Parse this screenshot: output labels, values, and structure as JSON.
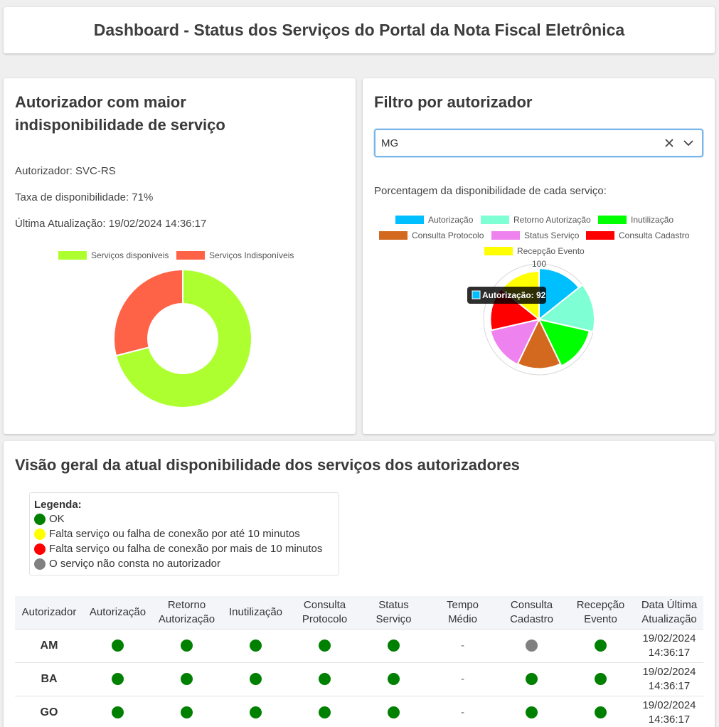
{
  "header": {
    "title": "Dashboard - Status dos Serviços do Portal da Nota Fiscal Eletrônica"
  },
  "left_card": {
    "title_line1": "Autorizador com maior",
    "title_line2": "indisponibilidade de serviço",
    "autorizador": "Autorizador: SVC-RS",
    "taxa": "Taxa de disponibilidade: 71%",
    "ultima": "Última Atualização: 19/02/2024 14:36:17",
    "chart_data": {
      "type": "pie",
      "variant": "doughnut",
      "categories": [
        "Serviços disponíveis",
        "Serviços Indisponíveis"
      ],
      "values": [
        71,
        29
      ],
      "colors": [
        "#adff2f",
        "#ff6347"
      ],
      "legend": "top"
    }
  },
  "right_card": {
    "title": "Filtro por autorizador",
    "select": {
      "value": "MG",
      "clear_icon": "close-icon",
      "open_icon": "chevron-down-icon"
    },
    "subtitle": "Porcentagem da disponibilidade de cada serviço:",
    "chart_data": {
      "type": "polarArea",
      "categories": [
        "Autorização",
        "Retorno Autorização",
        "Inutilização",
        "Consulta Protocolo",
        "Status Serviço",
        "Consulta Cadastro",
        "Recepção Evento"
      ],
      "values": [
        92,
        100,
        93,
        89,
        90,
        88,
        87
      ],
      "colors": [
        "#00bfff",
        "#7fffd4",
        "#00ff00",
        "#d2691e",
        "#ee82ee",
        "#ff0000",
        "#ffff00"
      ],
      "r_max": 100,
      "tick_label": "100",
      "legend": "top",
      "tooltip": {
        "label": "Autorização: 92",
        "color": "#00bfff"
      }
    }
  },
  "bottom_card": {
    "title": "Visão geral da atual disponibilidade dos serviços dos autorizadores",
    "legend": {
      "title": "Legenda:",
      "items": [
        {
          "color": "#008000",
          "label": "OK"
        },
        {
          "color": "#ffff00",
          "label": "Falta serviço ou falha de conexão por até 10 minutos"
        },
        {
          "color": "#ff0000",
          "label": "Falta serviço ou falha de conexão por mais de 10 minutos"
        },
        {
          "color": "#808080",
          "label": "O serviço não consta no autorizador"
        }
      ]
    },
    "table": {
      "headers": [
        [
          "Autorizador"
        ],
        [
          "Autorização"
        ],
        [
          "Retorno",
          "Autorização"
        ],
        [
          "Inutilização"
        ],
        [
          "Consulta",
          "Protocolo"
        ],
        [
          "Status",
          "Serviço"
        ],
        [
          "Tempo",
          "Médio"
        ],
        [
          "Consulta",
          "Cadastro"
        ],
        [
          "Recepção",
          "Evento"
        ],
        [
          "Data Última",
          "Atualização"
        ]
      ],
      "status_colors": {
        "ok": "#008000",
        "na": "#808080",
        "warn": "#ffff00",
        "err": "#ff0000"
      },
      "rows": [
        {
          "autorizador": "AM",
          "status": [
            "ok",
            "ok",
            "ok",
            "ok",
            "ok"
          ],
          "tempo": "-",
          "cadastro": "na",
          "evento": "ok",
          "data": "19/02/2024",
          "hora": "14:36:17"
        },
        {
          "autorizador": "BA",
          "status": [
            "ok",
            "ok",
            "ok",
            "ok",
            "ok"
          ],
          "tempo": "-",
          "cadastro": "ok",
          "evento": "ok",
          "data": "19/02/2024",
          "hora": "14:36:17"
        },
        {
          "autorizador": "GO",
          "status": [
            "ok",
            "ok",
            "ok",
            "ok",
            "ok"
          ],
          "tempo": "-",
          "cadastro": "ok",
          "evento": "ok",
          "data": "19/02/2024",
          "hora": "14:36:17"
        }
      ]
    }
  }
}
